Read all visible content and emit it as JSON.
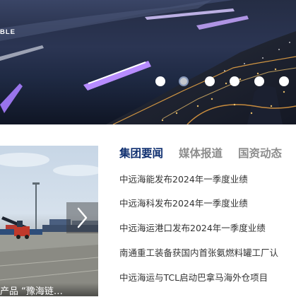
{
  "hero": {
    "caption": "BLE",
    "slide_count": 6,
    "active_slide": 2,
    "colors": {
      "water": "#2b3553",
      "lights": "#ffb347",
      "boat_glow": "#b78cff"
    }
  },
  "tabs": [
    {
      "label": "集团要闻",
      "active": true
    },
    {
      "label": "媒体报道",
      "active": false
    },
    {
      "label": "国资动态",
      "active": false
    }
  ],
  "news": [
    "中远海能发布2024年一季度业绩",
    "中远海科发布2024年一季度业绩",
    "中远海运港口发布2024年一季度业绩",
    "南通重工装备获国内首张氨燃料罐工厂认",
    "中远海运与TCL启动巴拿马海外仓项目"
  ],
  "photo": {
    "caption": "产品 “豫海链…",
    "next_icon": "chevron-right-icon"
  },
  "colors": {
    "active_tab": "#0f2f70",
    "inactive_tab": "#8d8d8d",
    "news_text": "#333333"
  }
}
